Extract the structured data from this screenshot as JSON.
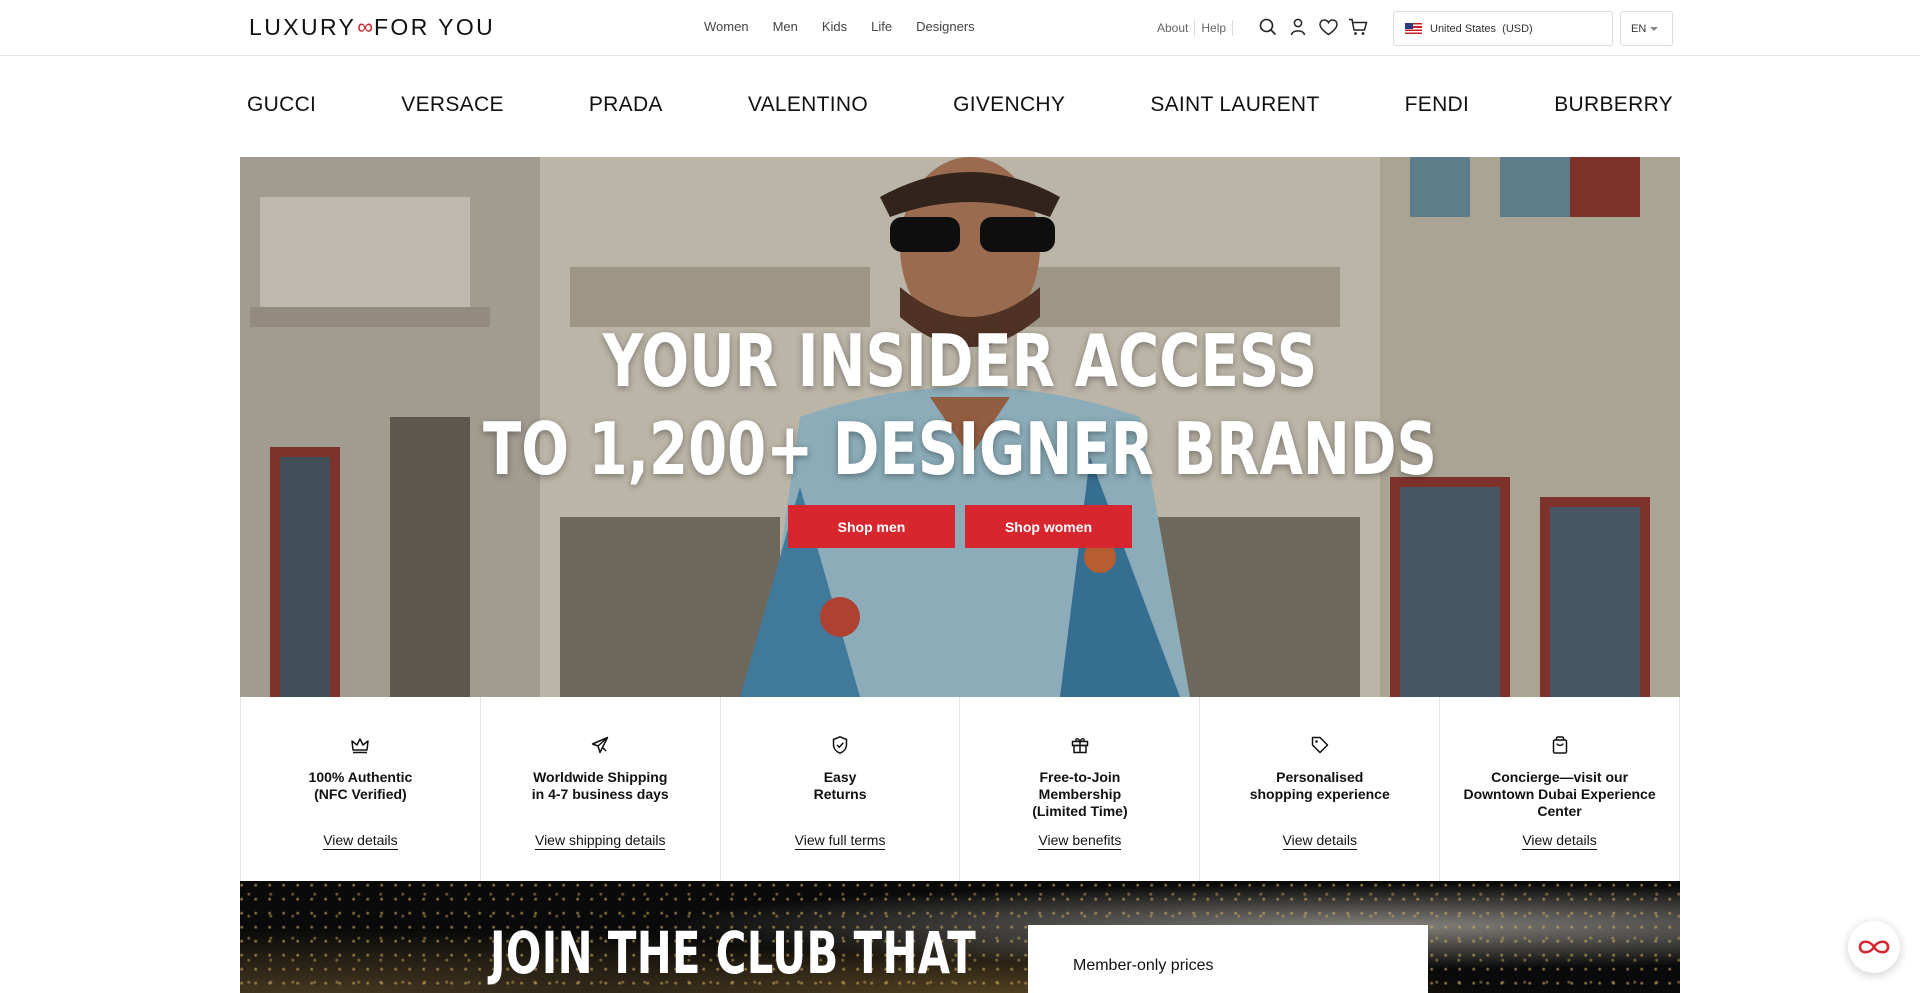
{
  "header": {
    "logo_left": "LUXURY",
    "logo_symbol": "∞",
    "logo_right": "FOR YOU",
    "nav": [
      "Women",
      "Men",
      "Kids",
      "Life",
      "Designers"
    ],
    "about": "About",
    "help": "Help",
    "icons": [
      "search-icon",
      "account-icon",
      "wishlist-icon",
      "cart-icon"
    ],
    "country": "United States  (USD)",
    "language": "EN"
  },
  "brands": [
    "GUCCI",
    "VERSACE",
    "PRADA",
    "VALENTINO",
    "GIVENCHY",
    "SAINT LAURENT",
    "FENDI",
    "BURBERRY"
  ],
  "hero": {
    "title_line1": "YOUR INSIDER ACCESS",
    "title_line2": "TO 1,200+ DESIGNER BRANDS",
    "shop_men": "Shop men",
    "shop_women": "Shop women",
    "button_color": "#d7262e"
  },
  "features": [
    {
      "icon": "crown-icon",
      "title": "100% Authentic\n(NFC Verified)",
      "link": "View details"
    },
    {
      "icon": "plane-icon",
      "title": "Worldwide Shipping\nin 4-7 business days",
      "link": "View shipping details"
    },
    {
      "icon": "shield-check-icon",
      "title": "Easy\nReturns",
      "link": "View full terms"
    },
    {
      "icon": "gift-icon",
      "title": "Free-to-Join\nMembership\n(Limited Time)",
      "link": "View benefits"
    },
    {
      "icon": "tag-icon",
      "title": "Personalised\nshopping experience",
      "link": "View details"
    },
    {
      "icon": "shopping-bag-icon",
      "title": "Concierge—visit our\nDowntown Dubai Experience\nCenter",
      "link": "View details"
    }
  ],
  "club": {
    "title": "JOIN THE CLUB THAT",
    "card_text": "Member-only prices"
  },
  "chat": {
    "icon": "infinity-chat-icon"
  }
}
